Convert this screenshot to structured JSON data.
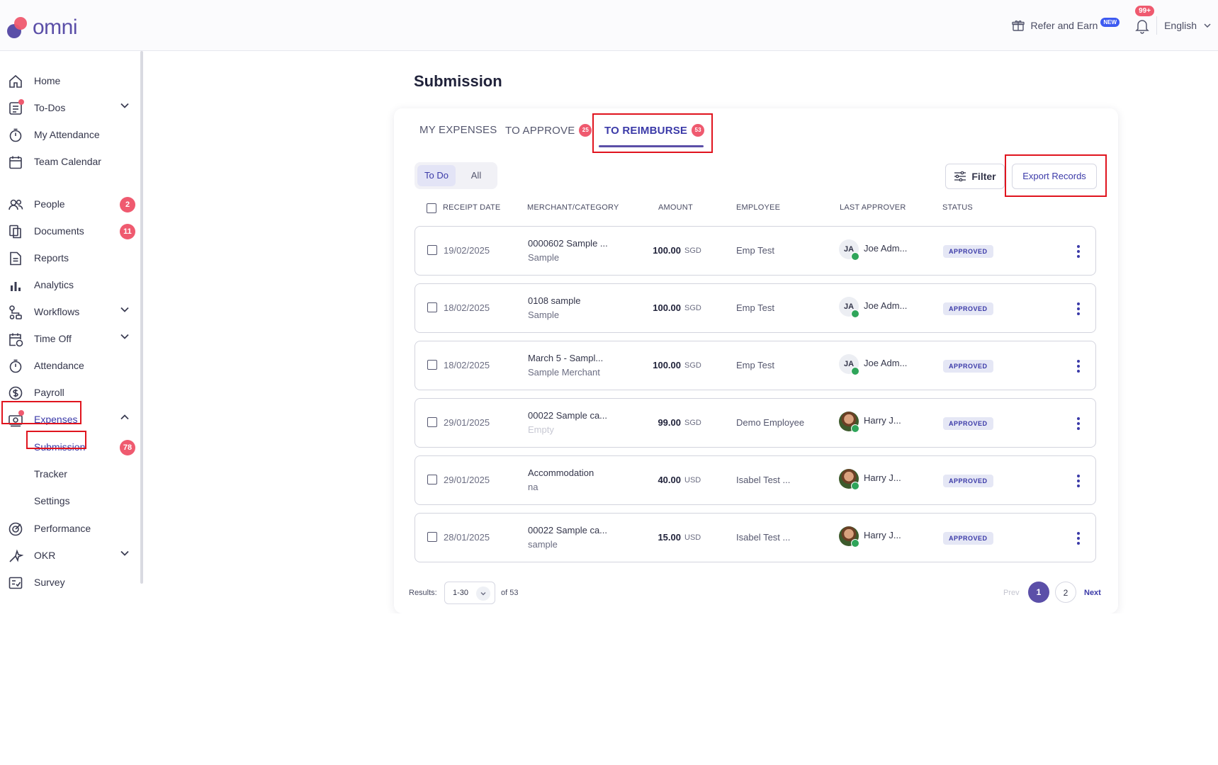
{
  "header": {
    "logo_text": "omni",
    "refer_label": "Refer and Earn",
    "new_badge": "NEW",
    "notification_count": "99+",
    "language": "English"
  },
  "sidebar": {
    "items": [
      {
        "label": "Home",
        "icon": "home-icon"
      },
      {
        "label": "To-Dos",
        "icon": "todo-list-icon"
      },
      {
        "label": "My Attendance",
        "icon": "stopwatch-icon"
      },
      {
        "label": "Team Calendar",
        "icon": "calendar-icon"
      },
      {
        "label": "People",
        "icon": "people-icon",
        "badge": "2"
      },
      {
        "label": "Documents",
        "icon": "documents-icon",
        "badge": "11"
      },
      {
        "label": "Reports",
        "icon": "report-icon"
      },
      {
        "label": "Analytics",
        "icon": "bar-chart-icon"
      },
      {
        "label": "Workflows",
        "icon": "workflow-icon"
      },
      {
        "label": "Time Off",
        "icon": "calendar-clock-icon"
      },
      {
        "label": "Attendance",
        "icon": "stopwatch-icon"
      },
      {
        "label": "Payroll",
        "icon": "dollar-icon"
      },
      {
        "label": "Expenses",
        "icon": "expenses-icon"
      },
      {
        "label": "Submission",
        "badge": "78"
      },
      {
        "label": "Tracker"
      },
      {
        "label": "Settings"
      },
      {
        "label": "Performance",
        "icon": "performance-icon"
      },
      {
        "label": "OKR",
        "icon": "okr-icon"
      },
      {
        "label": "Survey",
        "icon": "survey-icon"
      }
    ]
  },
  "main": {
    "title": "Submission",
    "tabs": [
      {
        "label": "MY EXPENSES"
      },
      {
        "label": "TO APPROVE",
        "badge": "25"
      },
      {
        "label": "TO REIMBURSE",
        "badge": "53"
      }
    ],
    "segments": [
      "To Do",
      "All"
    ],
    "filter_label": "Filter",
    "export_label": "Export Records",
    "columns": [
      "RECEIPT DATE",
      "MERCHANT/CATEGORY",
      "AMOUNT",
      "EMPLOYEE",
      "LAST APPROVER",
      "STATUS"
    ],
    "rows": [
      {
        "date": "19/02/2025",
        "merchant": "0000602 Sample ...",
        "category": "Sample",
        "amount": "100.00",
        "currency": "SGD",
        "employee": "Emp Test",
        "approver_initials": "JA",
        "approver": "Joe Adm...",
        "status": "APPROVED"
      },
      {
        "date": "18/02/2025",
        "merchant": "0108 sample",
        "category": "Sample",
        "amount": "100.00",
        "currency": "SGD",
        "employee": "Emp Test",
        "approver_initials": "JA",
        "approver": "Joe Adm...",
        "status": "APPROVED"
      },
      {
        "date": "18/02/2025",
        "merchant": "March 5 - Sampl...",
        "category": "Sample Merchant",
        "amount": "100.00",
        "currency": "SGD",
        "employee": "Emp Test",
        "approver_initials": "JA",
        "approver": "Joe Adm...",
        "status": "APPROVED"
      },
      {
        "date": "29/01/2025",
        "merchant": "00022 Sample ca...",
        "category": "Empty",
        "amount": "99.00",
        "currency": "SGD",
        "employee": "Demo Employee",
        "approver_initials": "",
        "approver": "Harry J...",
        "status": "APPROVED"
      },
      {
        "date": "29/01/2025",
        "merchant": "Accommodation",
        "category": "na",
        "amount": "40.00",
        "currency": "USD",
        "employee": "Isabel Test ...",
        "approver_initials": "",
        "approver": "Harry J...",
        "status": "APPROVED"
      },
      {
        "date": "28/01/2025",
        "merchant": "00022 Sample ca...",
        "category": "sample",
        "amount": "15.00",
        "currency": "USD",
        "employee": "Isabel Test ...",
        "approver_initials": "",
        "approver": "Harry J...",
        "status": "APPROVED"
      }
    ],
    "footer": {
      "results_label": "Results:",
      "range": "1-30",
      "of_total": "of 53",
      "prev": "Prev",
      "pages": [
        "1",
        "2"
      ],
      "next": "Next"
    }
  }
}
